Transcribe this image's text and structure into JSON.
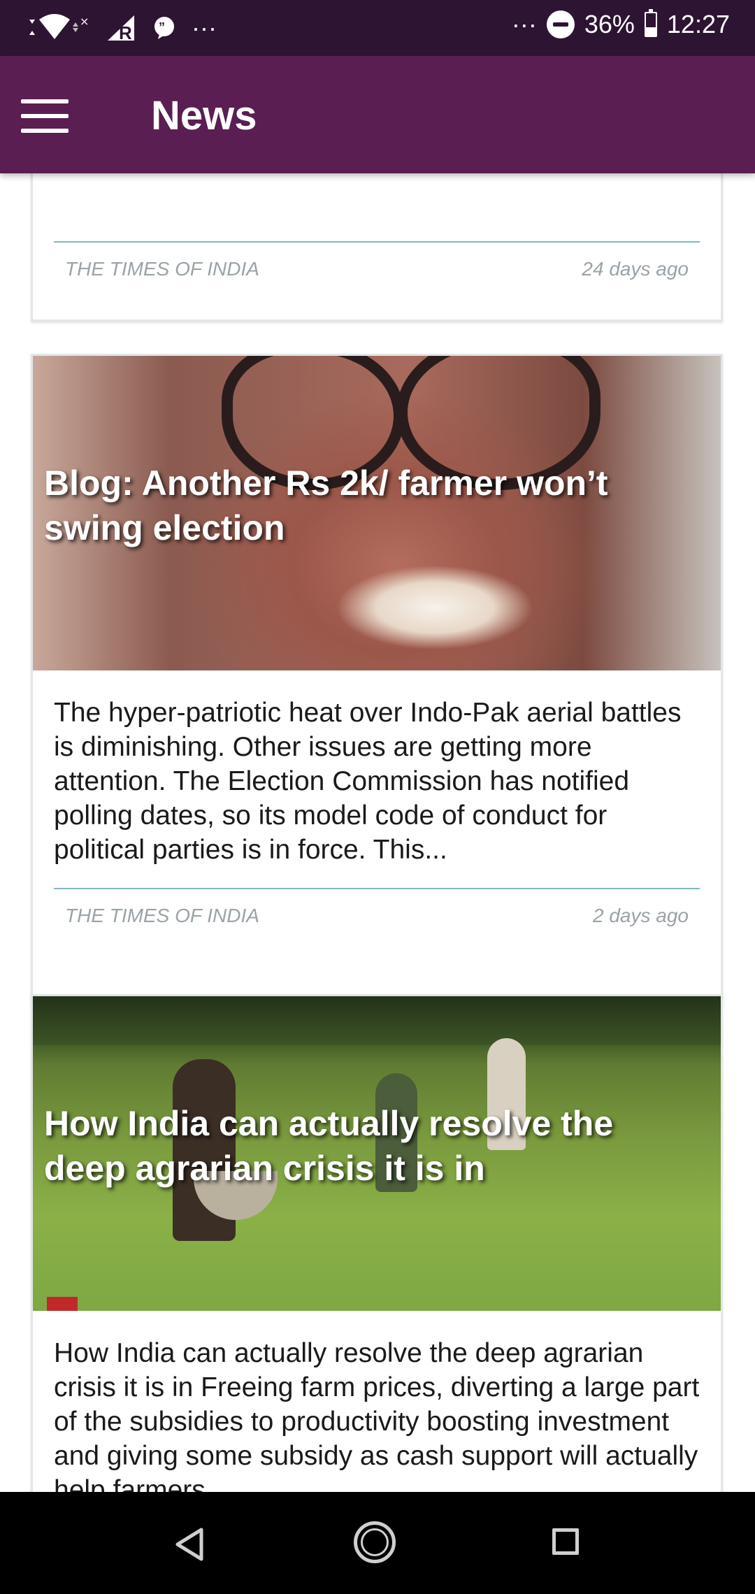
{
  "status_bar": {
    "battery": "36%",
    "time": "12:27",
    "overflow_left": "···",
    "overflow_right": "···",
    "icons": [
      "wifi-icon",
      "signal-icon",
      "roaming-r-icon",
      "message-icon",
      "do-not-disturb-icon",
      "battery-icon"
    ]
  },
  "app_bar": {
    "title": "News",
    "menu_icon": "hamburger-menu-icon",
    "color": "#5a1e52"
  },
  "articles": [
    {
      "source": "THE TIMES OF INDIA",
      "time": "24 days ago"
    },
    {
      "headline": "Blog: Another Rs 2k/ farmer won’t swing election",
      "summary": "The hyper-patriotic heat over Indo-Pak aerial battles is diminishing. Other issues are getting more attention. The Election Commission has notified polling dates, so its model code of conduct for political parties is in force. This...",
      "source": "THE TIMES OF INDIA",
      "time": "2 days ago"
    },
    {
      "headline": "How India can actually resolve the deep agrarian crisis it is in",
      "summary": "How India can actually resolve the deep agrarian crisis it is in Freeing farm prices, diverting a large part of the subsidies to productivity boosting investment and giving some subsidy as cash support will actually help farmers..."
    }
  ],
  "nav_bar": {
    "icons": [
      "back-icon",
      "home-icon",
      "recent-apps-icon"
    ]
  }
}
